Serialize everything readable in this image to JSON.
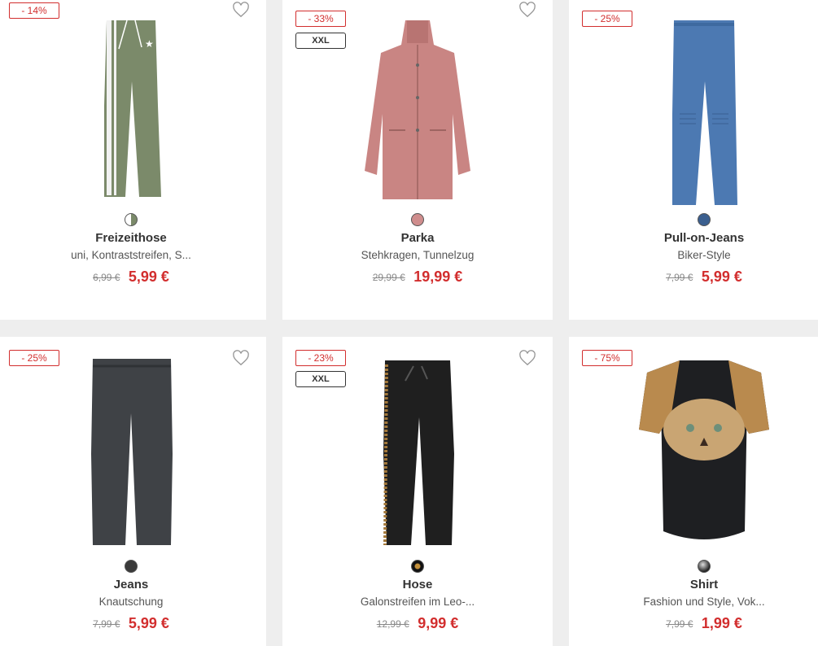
{
  "products": [
    {
      "discount": "- 14%",
      "size": "",
      "name": "Freizeithose",
      "desc": "uni, Kontraststreifen, S...",
      "old_price": "6,99 €",
      "price": "5,99 €"
    },
    {
      "discount": "- 33%",
      "size": "XXL",
      "name": "Parka",
      "desc": "Stehkragen, Tunnelzug",
      "old_price": "29,99 €",
      "price": "19,99 €"
    },
    {
      "discount": "- 25%",
      "size": "",
      "name": "Pull-on-Jeans",
      "desc": "Biker-Style",
      "old_price": "7,99 €",
      "price": "5,99 €"
    },
    {
      "discount": "- 25%",
      "size": "",
      "name": "Jeans",
      "desc": "Knautschung",
      "old_price": "7,99 €",
      "price": "5,99 €"
    },
    {
      "discount": "- 23%",
      "size": "XXL",
      "name": "Hose",
      "desc": "Galonstreifen im Leo-...",
      "old_price": "12,99 €",
      "price": "9,99 €"
    },
    {
      "discount": "- 75%",
      "size": "",
      "name": "Shirt",
      "desc": "Fashion und Style, Vok...",
      "old_price": "7,99 €",
      "price": "1,99 €"
    }
  ],
  "colors": {
    "accent": "#d22e2e",
    "text": "#333333",
    "background": "#eeeeee"
  },
  "swatches": [
    "#7b8a6a",
    "#cf8d8d",
    "#3b5f8f",
    "#3a3a3a",
    "#2b2118",
    "#555555"
  ]
}
